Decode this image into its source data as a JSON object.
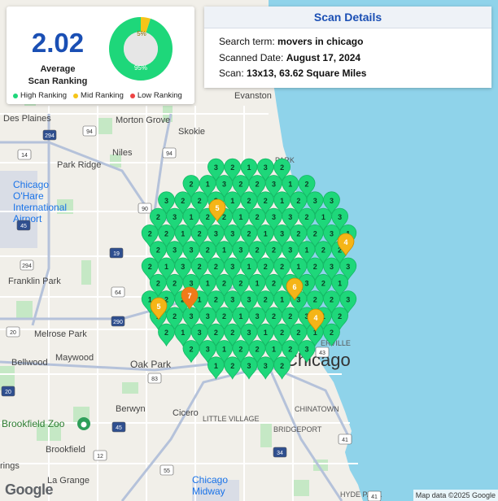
{
  "stats": {
    "average_value": "2.02",
    "average_label_line1": "Average",
    "average_label_line2": "Scan Ranking",
    "donut_labels": {
      "high": "95%",
      "mid": "5%"
    },
    "donut_fractions": {
      "high": 0.95,
      "mid": 0.05,
      "low": 0.0
    },
    "legend": [
      {
        "label": "High Ranking",
        "color": "#1ed77a"
      },
      {
        "label": "Mid Ranking",
        "color": "#f5c518"
      },
      {
        "label": "Low Ranking",
        "color": "#ee4444"
      }
    ]
  },
  "details": {
    "title": "Scan Details",
    "search_term_label": "Search term:",
    "search_term_value": "movers in chicago",
    "scanned_date_label": "Scanned Date:",
    "scanned_date_value": "August 17, 2024",
    "scan_label": "Scan:",
    "scan_value": "13x13, 63.62 Square Miles"
  },
  "map_labels": {
    "des_plaines": "Des Plaines",
    "morton_grove": "Morton Grove",
    "skokie": "Skokie",
    "evanston": "Evanston",
    "niles": "Niles",
    "park_ridge": "Park Ridge",
    "ohare_1": "Chicago",
    "ohare_2": "O'Hare",
    "ohare_3": "International",
    "ohare_4": "Airport",
    "franklin_park": "Franklin Park",
    "melrose_park": "Melrose Park",
    "bellwood": "Bellwood",
    "maywood": "Maywood",
    "oak_park": "Oak Park",
    "chicago": "Chicago",
    "streeterville": "ERVILLE",
    "berwyn": "Berwyn",
    "cicero": "Cicero",
    "little_village": "LITTLE VILLAGE",
    "chinatown": "CHINATOWN",
    "bridgeport": "BRIDGEPORT",
    "brookfield_zoo": "Brookfield Zoo",
    "brookfield": "Brookfield",
    "midway_1": "Chicago",
    "midway_2": "Midway",
    "hyde_park": "HYDE PARK",
    "la_grange": "La Grange",
    "springs": "rings",
    "park": "PARK"
  },
  "highway_shields": [
    "294",
    "94",
    "14",
    "45",
    "90",
    "94",
    "19",
    "294",
    "64",
    "290",
    "20",
    "83",
    "45",
    "12",
    "43",
    "34",
    "55",
    "41",
    "20",
    "41"
  ],
  "google_logo": "Google",
  "attribution": "Map data ©2025 Google",
  "pin_colors": {
    "high": "#1ed77a",
    "mid": "#f5b517",
    "low": "#f07a1a"
  },
  "pins": [
    {
      "rank": "2",
      "level": "high"
    },
    {
      "rank": "1",
      "level": "high"
    },
    {
      "rank": "2",
      "level": "high"
    },
    {
      "rank": "7",
      "level": "low"
    },
    {
      "rank": "5",
      "level": "mid"
    },
    {
      "rank": "5",
      "level": "mid"
    },
    {
      "rank": "6",
      "level": "mid"
    },
    {
      "rank": "4",
      "level": "mid"
    },
    {
      "rank": "4",
      "level": "mid"
    },
    {
      "rank": "3",
      "level": "high"
    },
    {
      "rank": "2",
      "level": "high"
    },
    {
      "rank": "1",
      "level": "high"
    }
  ]
}
